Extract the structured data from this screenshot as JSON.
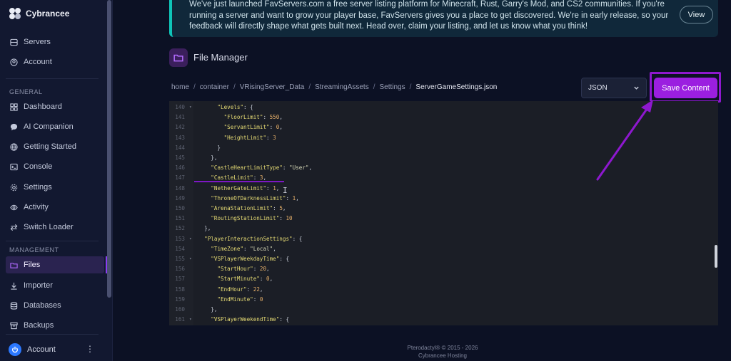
{
  "brand": {
    "name": "Cybrancee"
  },
  "sidebar": {
    "top_items": [
      {
        "label": "Servers",
        "icon": "server-icon"
      },
      {
        "label": "Account",
        "icon": "user-circle-icon"
      }
    ],
    "general_label": "GENERAL",
    "general_items": [
      {
        "label": "Dashboard",
        "icon": "grid-icon"
      },
      {
        "label": "AI Companion",
        "icon": "chat-bubble-icon"
      },
      {
        "label": "Getting Started",
        "icon": "globe-icon"
      },
      {
        "label": "Console",
        "icon": "terminal-icon"
      },
      {
        "label": "Settings",
        "icon": "gear-icon"
      },
      {
        "label": "Activity",
        "icon": "eye-icon"
      },
      {
        "label": "Switch Loader",
        "icon": "switch-arrows-icon"
      }
    ],
    "management_label": "MANAGEMENT",
    "management_items": [
      {
        "label": "Files",
        "icon": "folder-icon",
        "active": true
      },
      {
        "label": "Importer",
        "icon": "download-icon"
      },
      {
        "label": "Databases",
        "icon": "database-icon"
      },
      {
        "label": "Backups",
        "icon": "archive-icon"
      }
    ],
    "account_footer": {
      "label": "Account",
      "icon": "power-icon"
    }
  },
  "banner": {
    "text": "We've just launched FavServers.com a free server listing platform for Minecraft, Rust, Garry's Mod, and CS2 communities. If you're running a server and want to grow your player base, FavServers gives you a place to get discovered. We're in early release, so your feedback will directly shape what gets built next. Head over, claim your listing, and let us know what you think!",
    "button_label": "View"
  },
  "file_manager": {
    "title": "File Manager",
    "breadcrumb": [
      "home",
      "container",
      "VRisingServer_Data",
      "StreamingAssets",
      "Settings"
    ],
    "current_file": "ServerGameSettings.json",
    "format_select": "JSON",
    "save_label": "Save Content"
  },
  "editor": {
    "lines": [
      {
        "n": "140",
        "fold": true,
        "code": "      \"Levels\": {"
      },
      {
        "n": "141",
        "code": "        \"FloorLimit\": 550,"
      },
      {
        "n": "142",
        "code": "        \"ServantLimit\": 0,"
      },
      {
        "n": "143",
        "code": "        \"HeightLimit\": 3"
      },
      {
        "n": "144",
        "code": "      }"
      },
      {
        "n": "145",
        "code": "    },"
      },
      {
        "n": "146",
        "code": "    \"CastleHeartLimitType\": \"User\","
      },
      {
        "n": "147",
        "code": "    \"CastleLimit\": 3,"
      },
      {
        "n": "148",
        "code": "    \"NetherGateLimit\": 1,"
      },
      {
        "n": "149",
        "code": "    \"ThroneOfDarknessLimit\": 1,"
      },
      {
        "n": "150",
        "code": "    \"ArenaStationLimit\": 5,"
      },
      {
        "n": "151",
        "code": "    \"RoutingStationLimit\": 10"
      },
      {
        "n": "152",
        "code": "  },"
      },
      {
        "n": "153",
        "fold": true,
        "code": "  \"PlayerInteractionSettings\": {"
      },
      {
        "n": "154",
        "code": "    \"TimeZone\": \"Local\","
      },
      {
        "n": "155",
        "fold": true,
        "code": "    \"VSPlayerWeekdayTime\": {"
      },
      {
        "n": "156",
        "code": "      \"StartHour\": 20,"
      },
      {
        "n": "157",
        "code": "      \"StartMinute\": 0,"
      },
      {
        "n": "158",
        "code": "      \"EndHour\": 22,"
      },
      {
        "n": "159",
        "code": "      \"EndMinute\": 0"
      },
      {
        "n": "160",
        "code": "    },"
      },
      {
        "n": "161",
        "fold": true,
        "code": "    \"VSPlayerWeekendTime\": {"
      }
    ]
  },
  "footer": {
    "line1": "Pterodactyl® © 2015 - 2026",
    "line2": "Cybrancee Hosting"
  },
  "colors": {
    "accent": "#9b1fe0",
    "banner_border": "#0fc4b8",
    "annotation": "#8e18cf"
  }
}
